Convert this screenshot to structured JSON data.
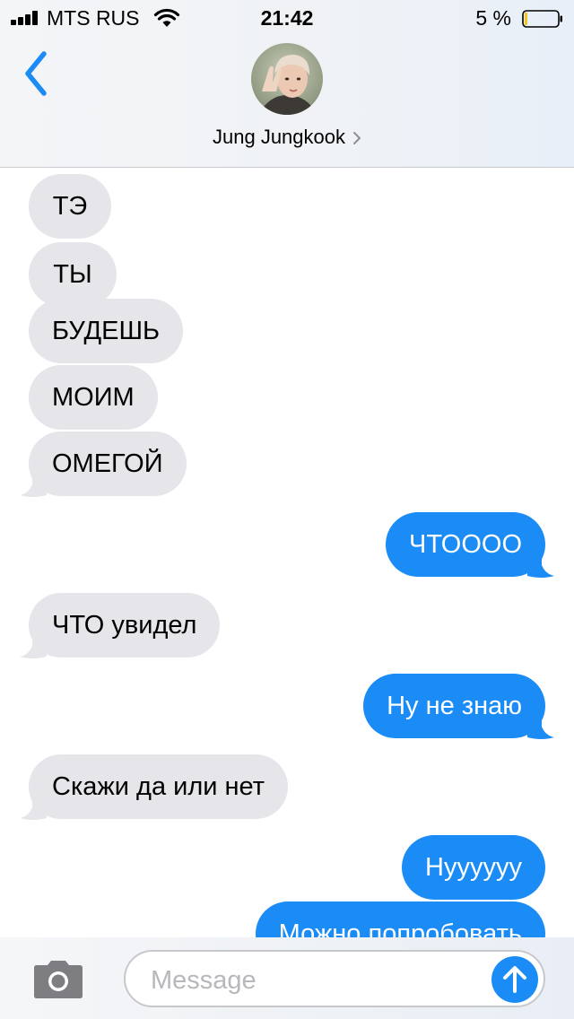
{
  "status_bar": {
    "carrier": "MTS RUS",
    "time": "21:42",
    "battery_percent": "5 %",
    "battery_level": 0.05,
    "signal_bars": 4
  },
  "header": {
    "contact_name": "Jung Jungkook"
  },
  "messages": [
    {
      "direction": "incoming",
      "text": "ТЭ"
    },
    {
      "direction": "incoming",
      "text": "ТЫ"
    },
    {
      "direction": "incoming",
      "text": "БУДЕШЬ"
    },
    {
      "direction": "incoming",
      "text": "МОИМ"
    },
    {
      "direction": "incoming",
      "text": "ОМЕГОЙ"
    },
    {
      "direction": "outgoing",
      "text": "ЧТОООО"
    },
    {
      "direction": "incoming",
      "text": "ЧТО увидел"
    },
    {
      "direction": "outgoing",
      "text": "Ну не знаю"
    },
    {
      "direction": "incoming",
      "text": "Скажи да или нет"
    },
    {
      "direction": "outgoing",
      "text": "Нуууууу"
    },
    {
      "direction": "outgoing",
      "text": "Можно попробовать"
    }
  ],
  "input": {
    "placeholder": "Message",
    "value": ""
  },
  "colors": {
    "accent": "#1b8cf5",
    "incoming_bubble": "#e5e5ea",
    "outgoing_bubble": "#1b8cf5",
    "battery_low": "#f5c518"
  },
  "icons": {
    "back": "chevron-left-icon",
    "contact_details": "chevron-right-icon",
    "camera": "camera-icon",
    "send": "arrow-up-icon",
    "wifi": "wifi-icon",
    "signal": "signal-bars-icon",
    "battery": "battery-icon"
  }
}
